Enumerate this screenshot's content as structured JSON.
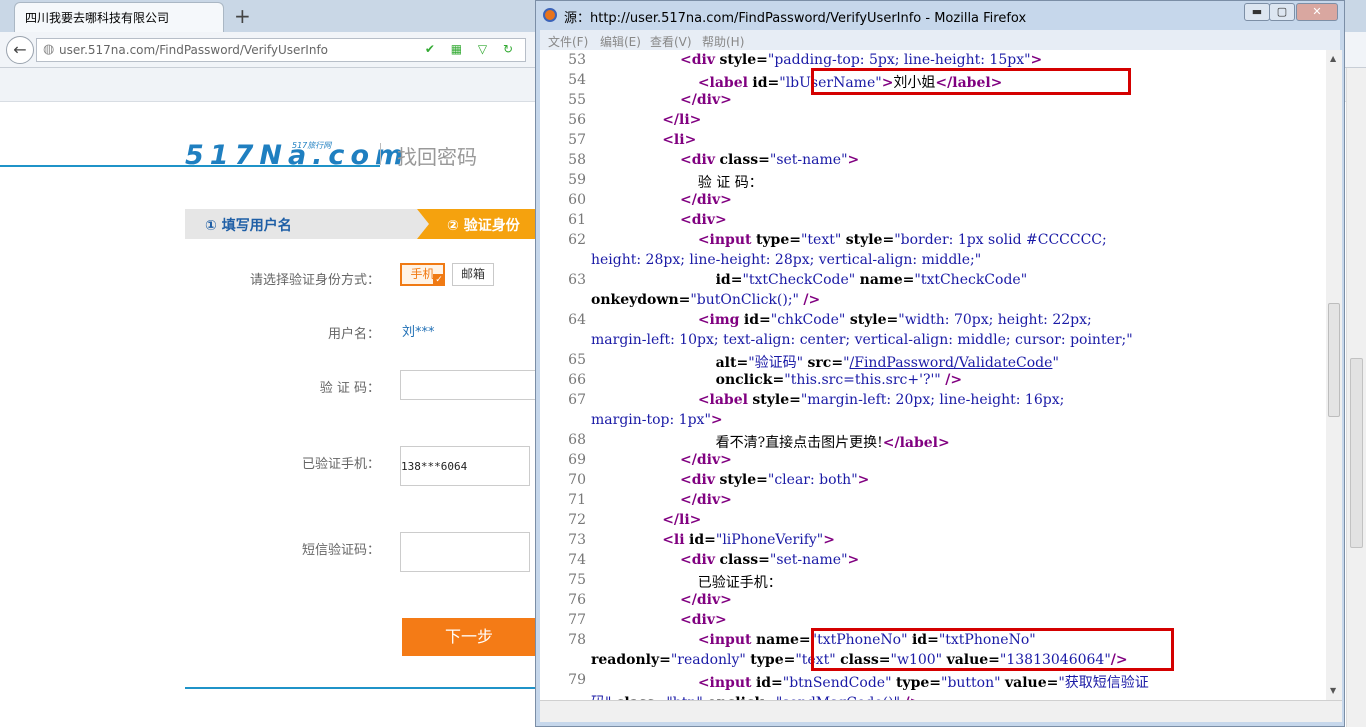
{
  "browser": {
    "tab_title": "四川我要去哪科技有限公司",
    "new_tab": "+",
    "back": "←",
    "url": "user.517na.com/FindPassword/VerifyUserInfo",
    "url_icons": "✔ ▦ ▽ ↻"
  },
  "page": {
    "logo_text": "517Na.com",
    "logo_sub": "517旅行网",
    "heading": "找回密码",
    "step1": "① 填写用户名",
    "step2": "② 验证身份",
    "label_method": "请选择验证身份方式：",
    "btn_phone": "手机",
    "btn_email": "邮箱",
    "label_user": "用户名：",
    "username": "刘***",
    "label_code": "验 证 码：",
    "label_phone": "已验证手机：",
    "phone_value": "138***6064",
    "label_sms": "短信验证码：",
    "next": "下一步"
  },
  "source_window": {
    "title": "源：http://user.517na.com/FindPassword/VerifyUserInfo - Mozilla Firefox",
    "min": "▬",
    "max": "▢",
    "close": "✕",
    "menu": {
      "file": "文件(F)",
      "edit": "编辑(E)",
      "view": "查看(V)",
      "help": "帮助(H)"
    },
    "line_numbers": [
      "53",
      "54",
      "55",
      "56",
      "57",
      "58",
      "59",
      "60",
      "61",
      "62",
      "63",
      "64",
      "65",
      "66",
      "67",
      "68",
      "69",
      "70",
      "71",
      "72",
      "73",
      "74",
      "75",
      "76",
      "77",
      "78",
      "79"
    ]
  }
}
